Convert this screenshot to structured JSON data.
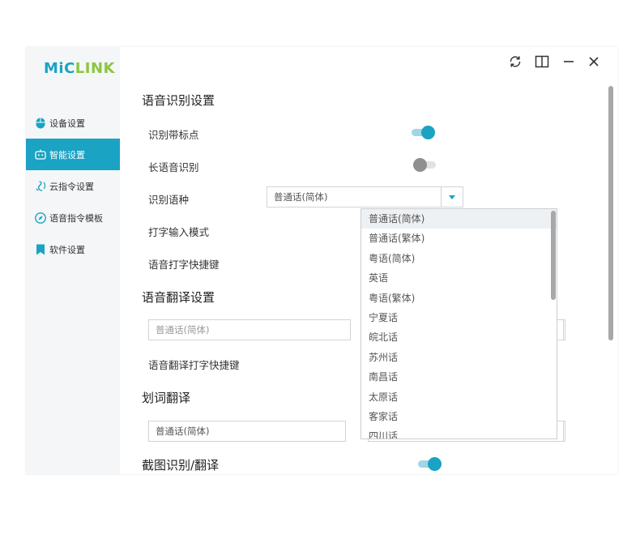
{
  "app": {
    "logo_part1": "MiC",
    "logo_part2": "LINK"
  },
  "colors": {
    "accent": "#1aa3c3",
    "logo_green": "#8cc63f",
    "sidebar_bg": "#f4f6f7"
  },
  "sidebar": {
    "items": [
      {
        "label": "设备设置",
        "icon": "mouse-icon"
      },
      {
        "label": "智能设置",
        "icon": "robot-icon",
        "active": true
      },
      {
        "label": "云指令设置",
        "icon": "voice-icon"
      },
      {
        "label": "语音指令模板",
        "icon": "compass-icon"
      },
      {
        "label": "软件设置",
        "icon": "bookmark-icon"
      }
    ]
  },
  "sections": {
    "recognition": {
      "title": "语音识别设置",
      "punct_label": "识别带标点",
      "punct_on": true,
      "long_label": "长语音识别",
      "long_on": false,
      "lang_label": "识别语种",
      "lang_value": "普通话(简体)",
      "input_mode_label": "打字输入模式",
      "hotkey_label": "语音打字快捷键"
    },
    "translation": {
      "title": "语音翻译设置",
      "source_value": "普通话(简体)",
      "hotkey_label": "语音翻译打字快捷键"
    },
    "word_translation": {
      "title": "划词翻译",
      "source_value": "普通话(简体)"
    },
    "screenshot": {
      "title": "截图识别/翻译",
      "on": true
    }
  },
  "dropdown": {
    "options": [
      "普通话(简体)",
      "普通话(繁体)",
      "粤语(简体)",
      "英语",
      "粤语(繁体)",
      "宁夏话",
      "皖北话",
      "苏州话",
      "南昌话",
      "太原话",
      "客家话",
      "四川话"
    ],
    "selected": "普通话(简体)"
  }
}
